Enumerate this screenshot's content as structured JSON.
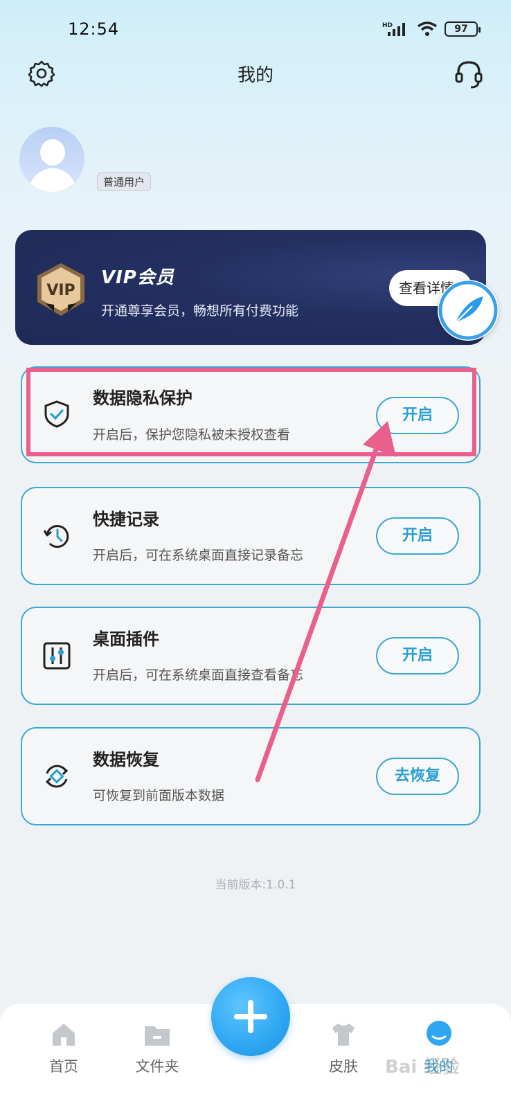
{
  "status_bar": {
    "time": "12:54",
    "network": "HD",
    "battery": "97"
  },
  "header": {
    "title": "我的",
    "settings_icon": "gear-icon",
    "service_icon": "headset-icon"
  },
  "profile": {
    "badge": "普通用户"
  },
  "vip": {
    "title": "VIP会员",
    "desc": "开通尊享会员，畅想所有付费功能",
    "button": "查看详情",
    "shield_text": "VIP"
  },
  "features": [
    {
      "title": "数据隐私保护",
      "desc": "开启后，保护您隐私被未授权查看",
      "button": "开启",
      "icon": "shield-check-icon"
    },
    {
      "title": "快捷记录",
      "desc": "开启后，可在系统桌面直接记录备忘",
      "button": "开启",
      "icon": "clock-history-icon"
    },
    {
      "title": "桌面插件",
      "desc": "开启后，可在系统桌面直接查看备忘",
      "button": "开启",
      "icon": "sliders-icon"
    },
    {
      "title": "数据恢复",
      "desc": "可恢复到前面版本数据",
      "button": "去恢复",
      "icon": "restore-icon"
    }
  ],
  "version": "当前版本:1.0.1",
  "nav": [
    {
      "label": "首页",
      "icon": "home-icon"
    },
    {
      "label": "文件夹",
      "icon": "folder-icon"
    },
    {
      "label": "皮肤",
      "icon": "shirt-icon"
    },
    {
      "label": "我的",
      "icon": "profile-icon",
      "active": true
    }
  ],
  "watermark": "Bai 经验",
  "colors": {
    "accent": "#39a8d3",
    "highlight": "#e9608c",
    "vip_bg": "#1e2a56",
    "fab": "#2fa6f2"
  }
}
